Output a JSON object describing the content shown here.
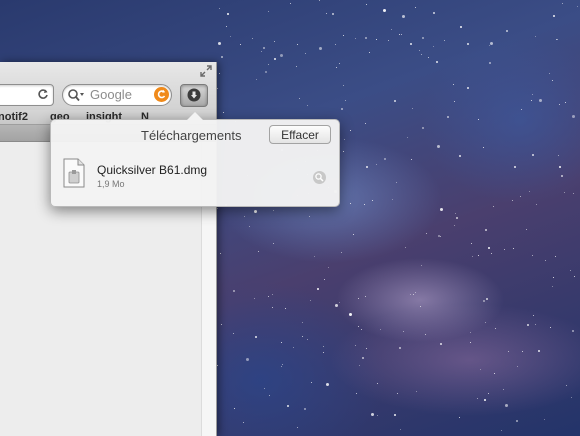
{
  "browser": {
    "search": {
      "placeholder": "Google"
    },
    "bookmarks": [
      "notif2",
      "geo",
      "insight",
      "N"
    ]
  },
  "downloads": {
    "title": "Téléchargements",
    "clear_label": "Effacer",
    "items": [
      {
        "name": "Quicksilver B61.dmg",
        "size": "1,9 Mo"
      }
    ]
  }
}
